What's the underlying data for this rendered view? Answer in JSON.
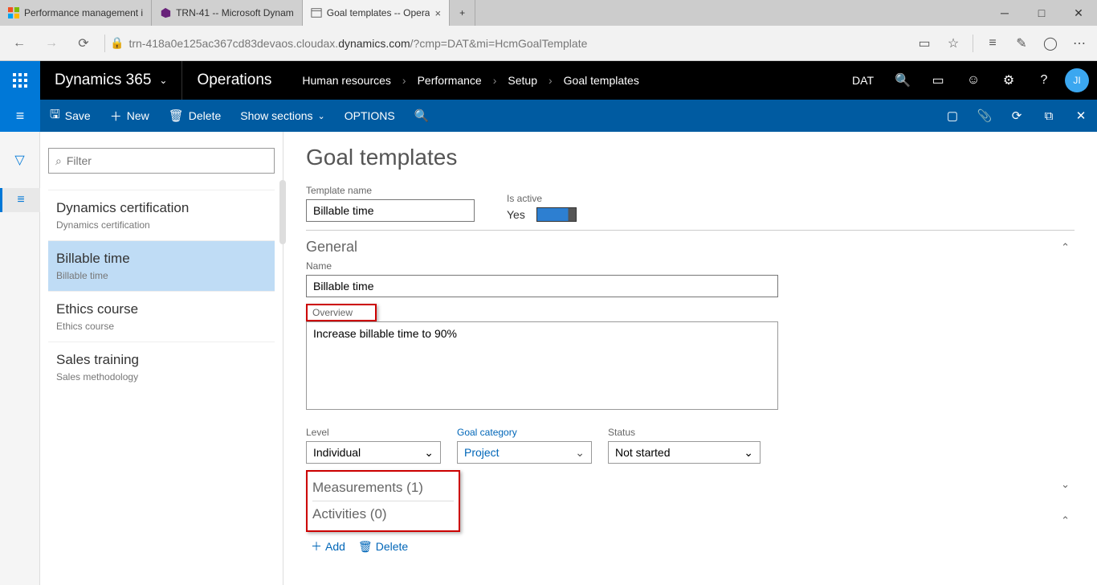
{
  "browser": {
    "tabs": [
      {
        "label": "Performance management i"
      },
      {
        "label": "TRN-41 -- Microsoft Dynam"
      },
      {
        "label": "Goal templates -- Opera"
      }
    ],
    "url_prefix": "trn-418a0e125ac367cd83devaos.cloudax.",
    "url_host": "dynamics.com",
    "url_suffix": "/?cmp=DAT&mi=HcmGoalTemplate"
  },
  "appTop": {
    "brand": "Dynamics 365",
    "product": "Operations",
    "breadcrumbs": [
      "Human resources",
      "Performance",
      "Setup",
      "Goal templates"
    ],
    "company": "DAT",
    "avatar": "JI"
  },
  "actionBar": {
    "save": "Save",
    "new": "New",
    "delete": "Delete",
    "showSections": "Show sections",
    "options": "OPTIONS"
  },
  "listPanel": {
    "filterPlaceholder": "Filter",
    "items": [
      {
        "title": "Dynamics certification",
        "sub": "Dynamics certification"
      },
      {
        "title": "Billable time",
        "sub": "Billable time"
      },
      {
        "title": "Ethics course",
        "sub": "Ethics course"
      },
      {
        "title": "Sales training",
        "sub": "Sales methodology"
      }
    ]
  },
  "page": {
    "title": "Goal templates",
    "templateNameLabel": "Template name",
    "templateName": "Billable time",
    "isActiveLabel": "Is active",
    "isActiveText": "Yes",
    "general": {
      "header": "General",
      "nameLabel": "Name",
      "name": "Billable time",
      "overviewLabel": "Overview",
      "overview": "Increase billable time to 90%",
      "levelLabel": "Level",
      "level": "Individual",
      "goalCategoryLabel": "Goal category",
      "goalCategory": "Project",
      "statusLabel": "Status",
      "status": "Not started"
    },
    "measurements": "Measurements (1)",
    "activities": "Activities (0)",
    "add": "Add",
    "deleteSub": "Delete"
  }
}
